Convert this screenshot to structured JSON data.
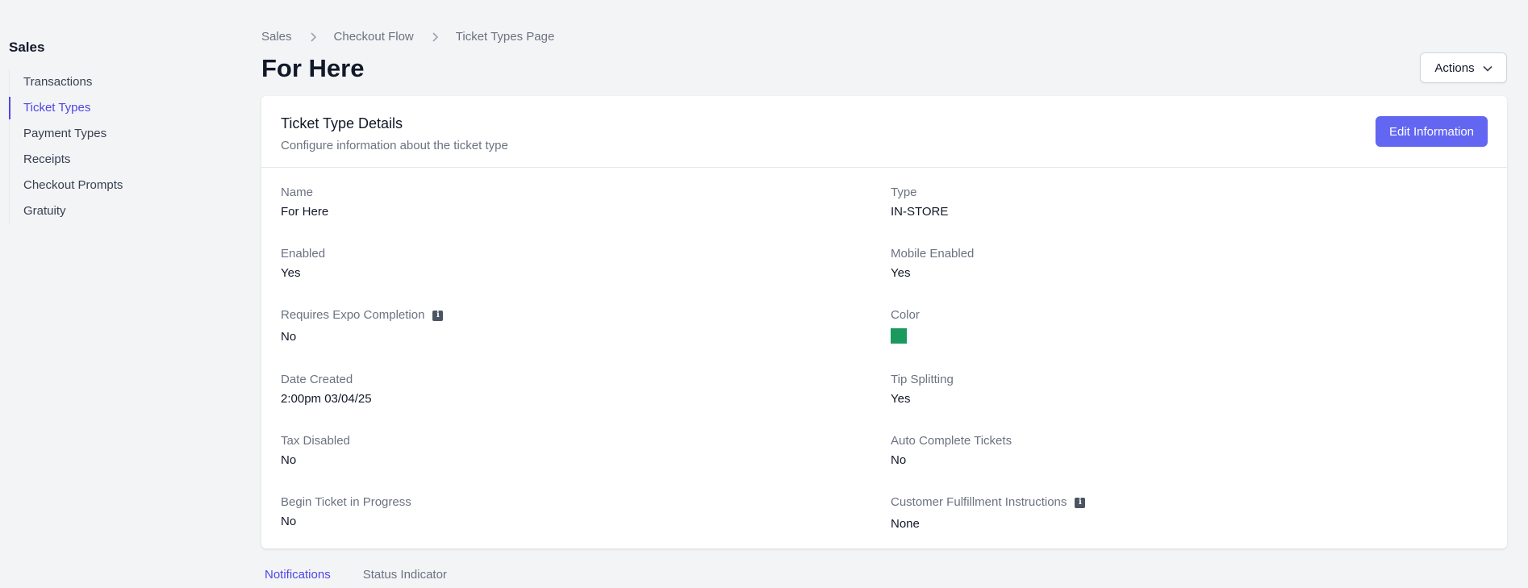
{
  "sidebar": {
    "title": "Sales",
    "items": [
      {
        "label": "Transactions"
      },
      {
        "label": "Ticket Types"
      },
      {
        "label": "Payment Types"
      },
      {
        "label": "Receipts"
      },
      {
        "label": "Checkout Prompts"
      },
      {
        "label": "Gratuity"
      }
    ],
    "active_index": 1
  },
  "breadcrumb": [
    "Sales",
    "Checkout Flow",
    "Ticket Types Page"
  ],
  "page": {
    "title": "For Here",
    "actions_label": "Actions"
  },
  "card": {
    "title": "Ticket Type Details",
    "subtitle": "Configure information about the ticket type",
    "edit_label": "Edit Information",
    "fields": {
      "name": {
        "label": "Name",
        "value": "For Here"
      },
      "type": {
        "label": "Type",
        "value": "IN-STORE"
      },
      "enabled": {
        "label": "Enabled",
        "value": "Yes"
      },
      "mobile_enabled": {
        "label": "Mobile Enabled",
        "value": "Yes"
      },
      "requires_expo": {
        "label": "Requires Expo Completion",
        "value": "No"
      },
      "color": {
        "label": "Color",
        "value": "#1a9a5e"
      },
      "date_created": {
        "label": "Date Created",
        "value": "2:00pm 03/04/25"
      },
      "tip_splitting": {
        "label": "Tip Splitting",
        "value": "Yes"
      },
      "tax_disabled": {
        "label": "Tax Disabled",
        "value": "No"
      },
      "auto_complete": {
        "label": "Auto Complete Tickets",
        "value": "No"
      },
      "begin_in_progress": {
        "label": "Begin Ticket in Progress",
        "value": "No"
      },
      "customer_fulfillment": {
        "label": "Customer Fulfillment Instructions",
        "value": "None"
      }
    }
  },
  "tabs": [
    {
      "label": "Notifications",
      "active": true
    },
    {
      "label": "Status Indicator",
      "active": false
    }
  ],
  "colors": {
    "accent": "#4f46e5",
    "button": "#6366f1",
    "swatch": "#1a9a5e"
  }
}
